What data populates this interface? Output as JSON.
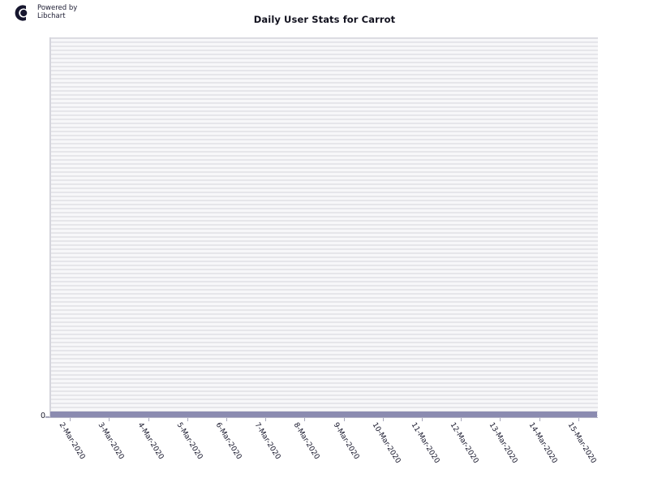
{
  "branding": {
    "line1": "Powered by",
    "line2": "Libchart",
    "logo_icon": "libchart-logo-icon",
    "logo_color": "#16162e"
  },
  "chart_data": {
    "type": "bar",
    "title": "Daily User Stats for Carrot",
    "xlabel": "",
    "ylabel": "",
    "categories": [
      "2-Mar-2020",
      "3-Mar-2020",
      "4-Mar-2020",
      "5-Mar-2020",
      "6-Mar-2020",
      "7-Mar-2020",
      "8-Mar-2020",
      "9-Mar-2020",
      "10-Mar-2020",
      "11-Mar-2020",
      "12-Mar-2020",
      "13-Mar-2020",
      "14-Mar-2020",
      "15-Mar-2020"
    ],
    "values": [
      0,
      0,
      0,
      0,
      0,
      0,
      0,
      0,
      0,
      0,
      0,
      0,
      0,
      0
    ],
    "ytick_labels": [
      "0"
    ],
    "ylim": [
      0,
      0
    ],
    "grid": true,
    "legend": false,
    "series_color": "#8b8bb0",
    "plot_background": "#f2f2f5",
    "gridline_color": "#e6e6ea"
  }
}
